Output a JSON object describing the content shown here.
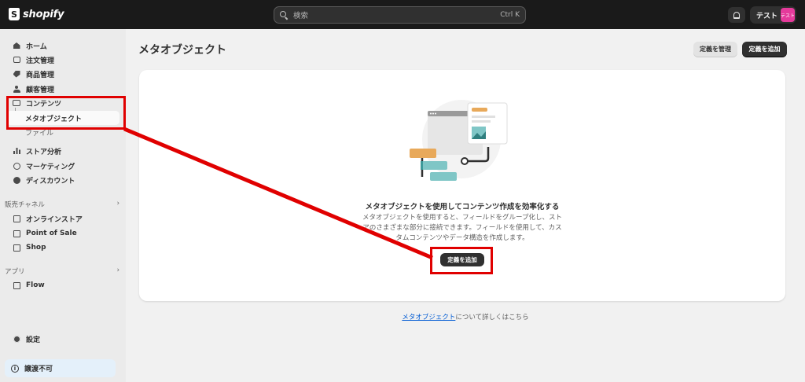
{
  "topbar": {
    "logo_text": "shopify",
    "search_placeholder": "検索",
    "search_shortcut": "Ctrl K",
    "account_name": "テスト",
    "account_avatar": "テスト"
  },
  "sidebar": {
    "items": [
      {
        "label": "ホーム",
        "icon": "home-icon"
      },
      {
        "label": "注文管理",
        "icon": "inbox-icon"
      },
      {
        "label": "商品管理",
        "icon": "tag-icon"
      },
      {
        "label": "顧客管理",
        "icon": "person-icon"
      },
      {
        "label": "コンテンツ",
        "icon": "content-icon"
      },
      {
        "label": "メタオブジェクト",
        "icon": ""
      },
      {
        "label": "ファイル",
        "icon": ""
      },
      {
        "label": "ストア分析",
        "icon": "bar-chart-icon"
      },
      {
        "label": "マーケティング",
        "icon": "target-icon"
      },
      {
        "label": "ディスカウント",
        "icon": "discount-icon"
      }
    ],
    "sales_channels_title": "販売チャネル",
    "sales_channels": [
      {
        "label": "オンラインストア",
        "icon": "store-icon"
      },
      {
        "label": "Point of Sale",
        "icon": "pos-icon"
      },
      {
        "label": "Shop",
        "icon": "shop-icon"
      }
    ],
    "apps_title": "アプリ",
    "apps": [
      {
        "label": "Flow",
        "icon": "flow-icon"
      }
    ],
    "settings_label": "設定",
    "alert_label": "譲渡不可"
  },
  "main": {
    "page_title": "メタオブジェクト",
    "manage_button": "定義を管理",
    "add_button": "定義を追加",
    "empty_title": "メタオブジェクトを使用してコンテンツ作成を効率化する",
    "empty_desc_line1": "メタオブジェクトを使用すると、フィールドをグループ化し、スト",
    "empty_desc_line2": "アのさまざまな部分に接続できます。フィールドを使用して、カス",
    "empty_desc_line3": "タムコンテンツやデータ構造を作成します。",
    "center_add_button": "定義を追加",
    "learn_link": "メタオブジェクト",
    "learn_suffix": "について詳しくはこちら"
  },
  "annotation_color": "#e00000"
}
